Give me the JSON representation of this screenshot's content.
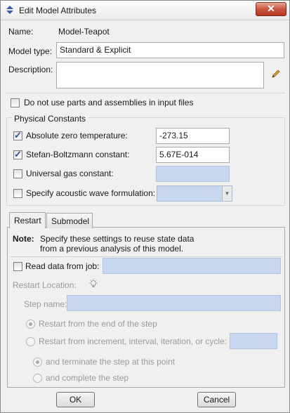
{
  "window": {
    "title": "Edit Model Attributes",
    "close_glyph": "✕"
  },
  "model": {
    "name_label": "Name:",
    "name_value": "Model-Teapot",
    "type_label": "Model type:",
    "type_value": "Standard & Explicit",
    "description_label": "Description:",
    "description_value": ""
  },
  "options": {
    "no_parts_label": "Do not use parts and assemblies in input files",
    "no_parts_checked": false
  },
  "physical_constants": {
    "title": "Physical Constants",
    "abs_zero_label": "Absolute zero temperature:",
    "abs_zero_checked": true,
    "abs_zero_value": "-273.15",
    "stefan_label": "Stefan-Boltzmann constant:",
    "stefan_checked": true,
    "stefan_value": "5.67E-014",
    "gas_label": "Universal gas constant:",
    "gas_checked": false,
    "gas_value": "",
    "acoustic_label": "Specify acoustic wave formulation:",
    "acoustic_checked": false,
    "acoustic_value": ""
  },
  "tabs": [
    {
      "label": "Restart",
      "active": true
    },
    {
      "label": "Submodel",
      "active": false
    }
  ],
  "restart": {
    "note_label": "Note:",
    "note_text_1": "Specify these settings to reuse state data",
    "note_text_2": "from a previous analysis of this model.",
    "read_label": "Read data from job:",
    "read_checked": false,
    "read_value": "",
    "location_label": "Restart Location:",
    "step_name_label": "Step name:",
    "step_name_value": "",
    "radio_end_label": "Restart from the end of the step",
    "radio_increment_label": "Restart from increment, interval, iteration, or cycle:",
    "increment_value": "",
    "terminate_label": "and terminate the step at this point",
    "complete_label": "and complete the step"
  },
  "buttons": {
    "ok": "OK",
    "cancel": "Cancel"
  }
}
